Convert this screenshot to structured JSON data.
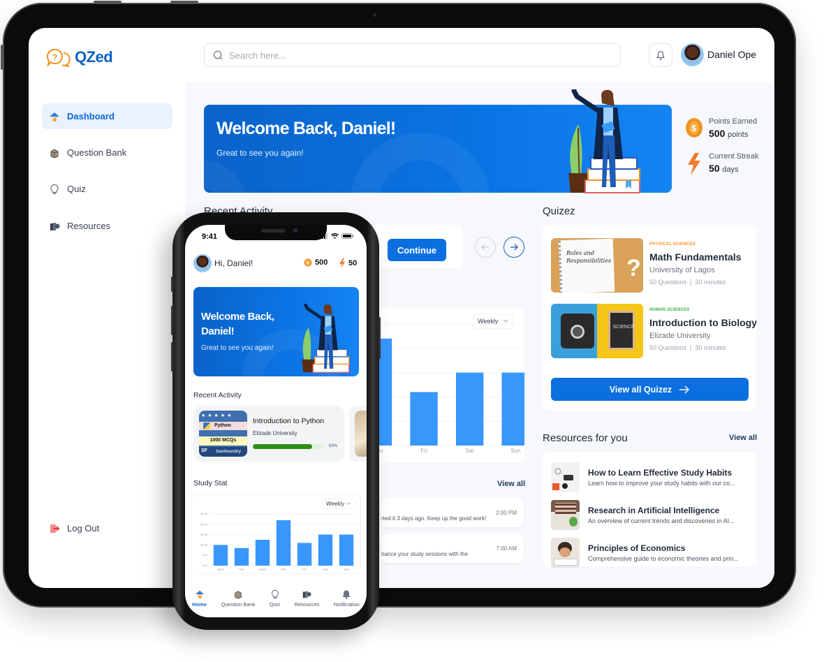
{
  "app": {
    "name": "QZed",
    "colors": {
      "brand_blue": "#0b62c6",
      "brand_orange": "#f5921e",
      "primary_button": "#0b6fe0",
      "bar": "#3797fb",
      "progress": "#2e8f16",
      "category_physical": "#f5921e",
      "category_human": "#3aa84a"
    }
  },
  "header": {
    "search_placeholder": "Search here...",
    "user_name": "Daniel Ope",
    "icons": {
      "search": "search-icon",
      "bell": "bell-icon"
    }
  },
  "sidebar": {
    "items": [
      {
        "label": "Dashboard",
        "icon": "home-icon",
        "active": true
      },
      {
        "label": "Question Bank",
        "icon": "question-box-icon",
        "active": false
      },
      {
        "label": "Quiz",
        "icon": "lightbulb-icon",
        "active": false
      },
      {
        "label": "Resources",
        "icon": "books-icon",
        "active": false
      }
    ],
    "logout": {
      "label": "Log Out",
      "icon": "logout-icon"
    }
  },
  "banner": {
    "title": "Welcome Back, Daniel!",
    "subtitle": "Great to see you again!"
  },
  "stats": {
    "points": {
      "label": "Points Earned",
      "value": "500",
      "unit": "points"
    },
    "streak": {
      "label": "Current Streak",
      "value": "50",
      "unit": "days"
    }
  },
  "recent_activity": {
    "title": "Recent Activity",
    "continue_label": "Continue",
    "prev_icon": "arrow-left-icon",
    "next_icon": "arrow-right-icon"
  },
  "study_chart": {
    "dropdown": "Weekly"
  },
  "notifications": {
    "view_all": "View all",
    "items": [
      {
        "text": "rted it 3 days ago. Keep up the good work!",
        "time": "2:00 PM"
      },
      {
        "text": "hance your study sessions with the",
        "time": "7:00 AM"
      }
    ]
  },
  "quizez": {
    "title": "Quizez",
    "items": [
      {
        "category": "PHYSICAL SCIENCES",
        "title": "Math Fundamentals",
        "university": "University of Lagos",
        "questions": "50 Questions",
        "duration": "30 minutes",
        "thumb_text": "Roles and Responsibilities"
      },
      {
        "category": "HUMAN SCIENCES",
        "title": "Introduction to Biology",
        "university": "Elizade University",
        "questions": "50 Questions",
        "duration": "30 minutes",
        "thumb_text": "SCIENCE"
      }
    ],
    "view_all_label": "View all Quizez"
  },
  "resources": {
    "title": "Resources for you",
    "view_all": "View all",
    "items": [
      {
        "title": "How to Learn Effective Study Habits",
        "description": "Learn how to improve your study habits with our co..."
      },
      {
        "title": "Research in Artificial Intelligence",
        "description": "An overview of current trends and discoveries in AI..."
      },
      {
        "title": "Principles of Economics",
        "description": " Comprehensive guide to economic theories and prin..."
      }
    ]
  },
  "phone": {
    "time": "9:41",
    "greeting": "Hi, Daniel!",
    "points": "500",
    "streak": "50",
    "banner_title": "Welcome Back, Daniel!",
    "banner_subtitle": "Great to see you again!",
    "recent_activity_title": "Recent Activity",
    "activity": {
      "title": "Introduction to  Python",
      "university": "Elizade University",
      "progress_percent": 83,
      "progress_label": "83%",
      "thumb": {
        "line1": "Python",
        "line2": "1000 MCQs",
        "line3": "Sanfoundry",
        "badge": "SF"
      }
    },
    "study_stat_title": "Study Stat",
    "dropdown": "Weekly",
    "nav": [
      {
        "label": "Home",
        "icon": "home-icon",
        "active": true
      },
      {
        "label": "Question Bank",
        "icon": "question-box-icon",
        "active": false
      },
      {
        "label": "Quiz",
        "icon": "lightbulb-icon",
        "active": false
      },
      {
        "label": "Resources",
        "icon": "books-icon",
        "active": false
      },
      {
        "label": "Notification",
        "icon": "bell-icon",
        "active": false
      }
    ]
  },
  "chart_data": {
    "type": "bar",
    "title": "Study Stat",
    "categories": [
      "Mon",
      "Tue",
      "Wed",
      "Thu",
      "Fri",
      "Sat",
      "Sun"
    ],
    "values": [
      10,
      8.5,
      12.5,
      22,
      11,
      15,
      15
    ],
    "unit": "hr",
    "yticks": [
      "0 hr",
      "5 hr",
      "10 hr",
      "15 hr",
      "20 hr",
      "25 hr"
    ],
    "ylim": [
      0,
      25
    ],
    "xlabel": "",
    "ylabel": "",
    "grid": true,
    "legend": "none"
  }
}
